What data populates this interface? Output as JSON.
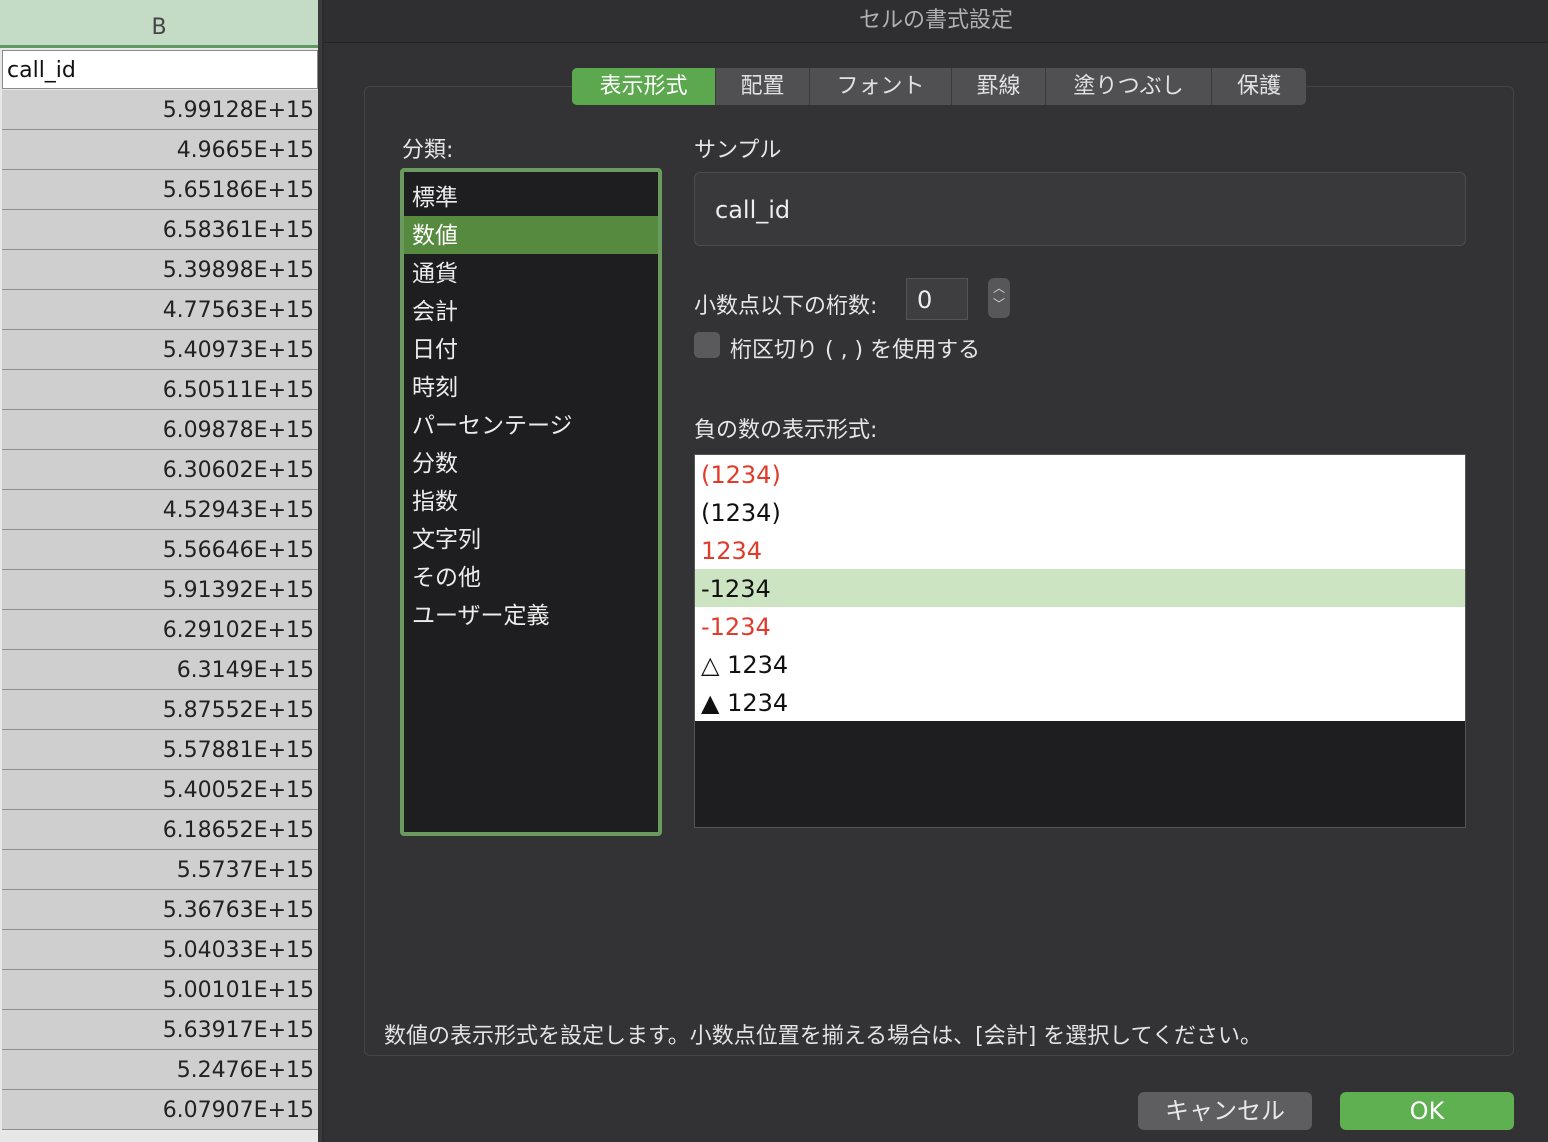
{
  "sheet": {
    "column_letter": "B",
    "header_cell": "call_id",
    "rows": [
      "5.99128E+15",
      "4.9665E+15",
      "5.65186E+15",
      "6.58361E+15",
      "5.39898E+15",
      "4.77563E+15",
      "5.40973E+15",
      "6.50511E+15",
      "6.09878E+15",
      "6.30602E+15",
      "4.52943E+15",
      "5.56646E+15",
      "5.91392E+15",
      "6.29102E+15",
      "6.3149E+15",
      "5.87552E+15",
      "5.57881E+15",
      "5.40052E+15",
      "6.18652E+15",
      "5.5737E+15",
      "5.36763E+15",
      "5.04033E+15",
      "5.00101E+15",
      "5.63917E+15",
      "5.2476E+15",
      "6.07907E+15"
    ]
  },
  "dialog": {
    "title": "セルの書式設定",
    "tabs": [
      {
        "label": "表示形式",
        "active": true
      },
      {
        "label": "配置",
        "active": false
      },
      {
        "label": "フォント",
        "active": false
      },
      {
        "label": "罫線",
        "active": false
      },
      {
        "label": "塗りつぶし",
        "active": false
      },
      {
        "label": "保護",
        "active": false
      }
    ],
    "category_label": "分類:",
    "categories": [
      "標準",
      "数値",
      "通貨",
      "会計",
      "日付",
      "時刻",
      "パーセンテージ",
      "分数",
      "指数",
      "文字列",
      "その他",
      "ユーザー定義"
    ],
    "selected_category": "数値",
    "sample_label": "サンプル",
    "sample_value": "call_id",
    "decimal_label": "小数点以下の桁数:",
    "decimal_value": "0",
    "thousands_label": "桁区切り ( , ) を使用する",
    "thousands_checked": false,
    "negative_label": "負の数の表示形式:",
    "negative_formats": [
      {
        "text": "(1234)",
        "color": "red"
      },
      {
        "text": "(1234)",
        "color": "black"
      },
      {
        "text": "1234",
        "color": "red"
      },
      {
        "text": "-1234",
        "color": "black",
        "selected": true
      },
      {
        "text": "-1234",
        "color": "red"
      },
      {
        "text": "△ 1234",
        "color": "black"
      },
      {
        "text": "▲ 1234",
        "color": "black"
      }
    ],
    "help_text": "数値の表示形式を設定します。小数点位置を揃える場合は、[会計] を選択してください。",
    "cancel_label": "キャンセル",
    "ok_label": "OK"
  },
  "colors": {
    "accent_green": "#5ba84f",
    "negative_red": "#e03c2c",
    "selected_row": "#cde4c3"
  }
}
